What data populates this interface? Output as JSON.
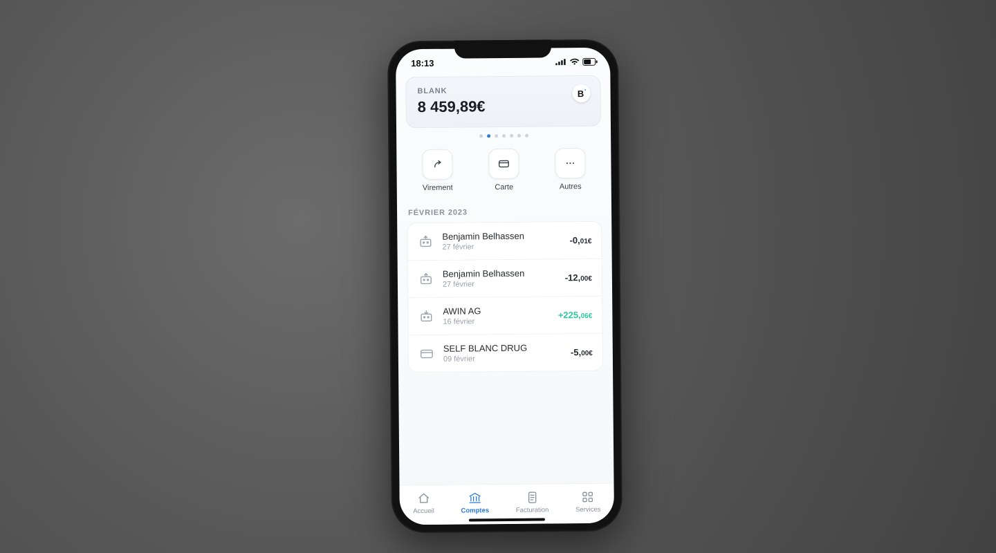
{
  "status": {
    "time": "18:13"
  },
  "account": {
    "name": "BLANK",
    "balance_int": "8 459,",
    "balance_cents": "89€",
    "brand_letter": "B"
  },
  "pager": {
    "count": 7,
    "active_index": 1
  },
  "actions": {
    "transfer": "Virement",
    "card": "Carte",
    "more": "Autres"
  },
  "section_header": "FÉVRIER 2023",
  "transactions": [
    {
      "icon": "transfer-out",
      "title": "Benjamin Belhassen",
      "date": "27 février",
      "amount_int": "-0,",
      "amount_cents": "01€",
      "positive": false
    },
    {
      "icon": "transfer-out",
      "title": "Benjamin Belhassen",
      "date": "27 février",
      "amount_int": "-12,",
      "amount_cents": "00€",
      "positive": false
    },
    {
      "icon": "transfer-in",
      "title": "AWIN AG",
      "date": "16 février",
      "amount_int": "+225,",
      "amount_cents": "06€",
      "positive": true
    },
    {
      "icon": "card",
      "title": "SELF BLANC DRUG",
      "date": "09 février",
      "amount_int": "-5,",
      "amount_cents": "00€",
      "positive": false
    }
  ],
  "nav": {
    "home": "Accueil",
    "accounts": "Comptes",
    "invoicing": "Facturation",
    "services": "Services",
    "active": "accounts"
  },
  "colors": {
    "accent": "#2a7bd6",
    "positive": "#2ec9a0"
  }
}
